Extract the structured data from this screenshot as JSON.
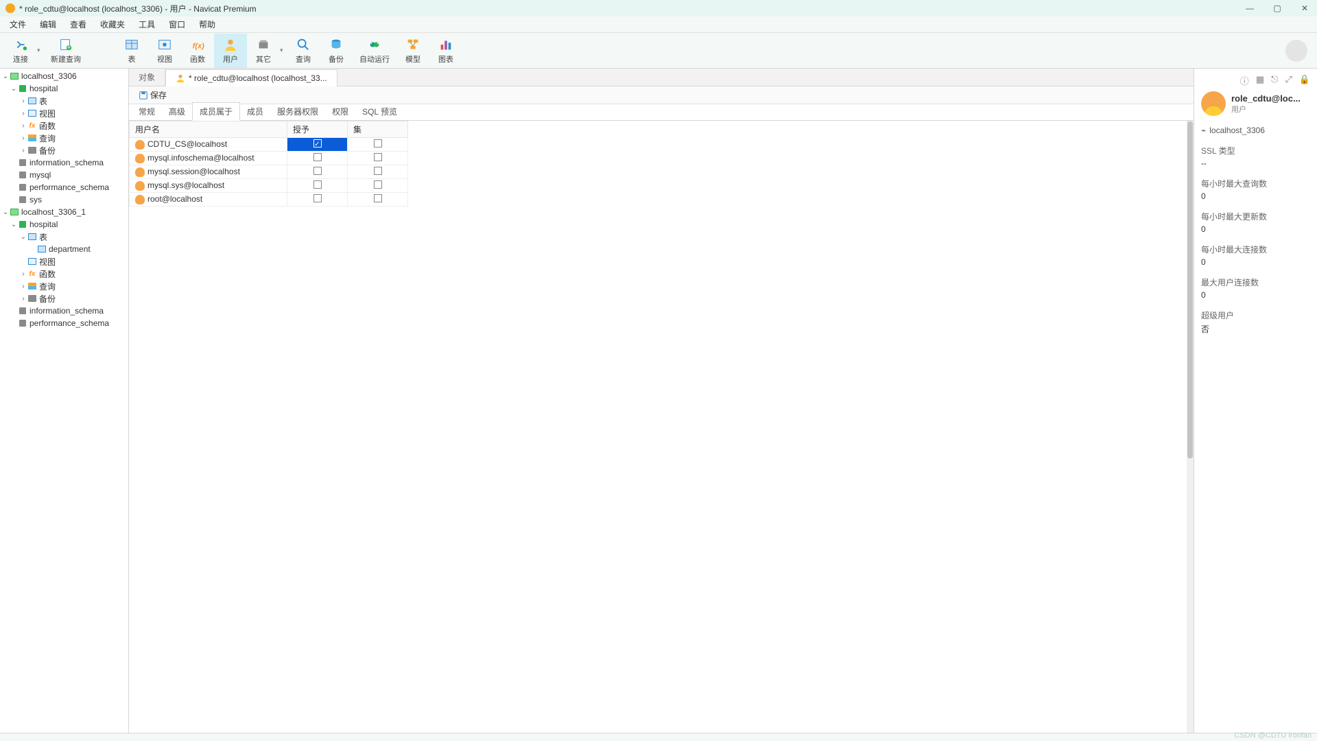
{
  "window": {
    "title": "* role_cdtu@localhost (localhost_3306) - 用户 - Navicat Premium"
  },
  "menubar": [
    "文件",
    "编辑",
    "查看",
    "收藏夹",
    "工具",
    "窗口",
    "帮助"
  ],
  "toolbar": [
    {
      "id": "connect",
      "label": "连接",
      "dropdown": true
    },
    {
      "id": "new-query",
      "label": "新建查询"
    },
    {
      "id": "table",
      "label": "表"
    },
    {
      "id": "view",
      "label": "视图"
    },
    {
      "id": "function",
      "label": "函数"
    },
    {
      "id": "user",
      "label": "用户",
      "active": true
    },
    {
      "id": "other",
      "label": "其它",
      "dropdown": true
    },
    {
      "id": "query",
      "label": "查询"
    },
    {
      "id": "backup",
      "label": "备份"
    },
    {
      "id": "autorun",
      "label": "自动运行"
    },
    {
      "id": "model",
      "label": "模型"
    },
    {
      "id": "chart",
      "label": "图表"
    }
  ],
  "tree": [
    {
      "depth": 0,
      "caret": "v",
      "icon": "conn",
      "label": "localhost_3306"
    },
    {
      "depth": 1,
      "caret": "v",
      "icon": "db",
      "label": "hospital"
    },
    {
      "depth": 2,
      "caret": ">",
      "icon": "tbl",
      "label": "表"
    },
    {
      "depth": 2,
      "caret": ">",
      "icon": "view",
      "label": "视图"
    },
    {
      "depth": 2,
      "caret": ">",
      "icon": "fx",
      "label": "函数"
    },
    {
      "depth": 2,
      "caret": ">",
      "icon": "qry",
      "label": "查询"
    },
    {
      "depth": 2,
      "caret": ">",
      "icon": "bak",
      "label": "备份"
    },
    {
      "depth": 1,
      "caret": "",
      "icon": "dbg",
      "label": "information_schema"
    },
    {
      "depth": 1,
      "caret": "",
      "icon": "dbg",
      "label": "mysql"
    },
    {
      "depth": 1,
      "caret": "",
      "icon": "dbg",
      "label": "performance_schema"
    },
    {
      "depth": 1,
      "caret": "",
      "icon": "dbg",
      "label": "sys"
    },
    {
      "depth": 0,
      "caret": "v",
      "icon": "conn",
      "label": "localhost_3306_1"
    },
    {
      "depth": 1,
      "caret": "v",
      "icon": "db",
      "label": "hospital"
    },
    {
      "depth": 2,
      "caret": "v",
      "icon": "tbl",
      "label": "表"
    },
    {
      "depth": 3,
      "caret": "",
      "icon": "tbl",
      "label": "department"
    },
    {
      "depth": 2,
      "caret": "",
      "icon": "view",
      "label": "视图"
    },
    {
      "depth": 2,
      "caret": ">",
      "icon": "fx",
      "label": "函数"
    },
    {
      "depth": 2,
      "caret": ">",
      "icon": "qry",
      "label": "查询"
    },
    {
      "depth": 2,
      "caret": ">",
      "icon": "bak",
      "label": "备份"
    },
    {
      "depth": 1,
      "caret": "",
      "icon": "dbg",
      "label": "information_schema"
    },
    {
      "depth": 1,
      "caret": "",
      "icon": "dbg",
      "label": "performance_schema"
    }
  ],
  "tabs": {
    "objects": "对象",
    "current": "* role_cdtu@localhost (localhost_33..."
  },
  "subtoolbar": {
    "save": "保存"
  },
  "subtabs": [
    "常规",
    "高级",
    "成员属于",
    "成员",
    "服务器权限",
    "权限",
    "SQL 预览"
  ],
  "subtab_active": 2,
  "grid": {
    "headers": [
      "用户名",
      "授予",
      "集"
    ],
    "rows": [
      {
        "user": "CDTU_CS@localhost",
        "grant": true,
        "set": false,
        "selected": true
      },
      {
        "user": "mysql.infoschema@localhost",
        "grant": false,
        "set": false
      },
      {
        "user": "mysql.session@localhost",
        "grant": false,
        "set": false
      },
      {
        "user": "mysql.sys@localhost",
        "grant": false,
        "set": false
      },
      {
        "user": "root@localhost",
        "grant": false,
        "set": false
      }
    ]
  },
  "info": {
    "name": "role_cdtu@loc...",
    "type": "用户",
    "connection": "localhost_3306",
    "props": [
      {
        "label": "SSL 类型",
        "value": "--"
      },
      {
        "label": "每小时最大查询数",
        "value": "0"
      },
      {
        "label": "每小时最大更新数",
        "value": "0"
      },
      {
        "label": "每小时最大连接数",
        "value": "0"
      },
      {
        "label": "最大用户连接数",
        "value": "0"
      },
      {
        "label": "超级用户",
        "value": "否"
      }
    ]
  },
  "watermark": "CSDN @CDTU ironfan"
}
